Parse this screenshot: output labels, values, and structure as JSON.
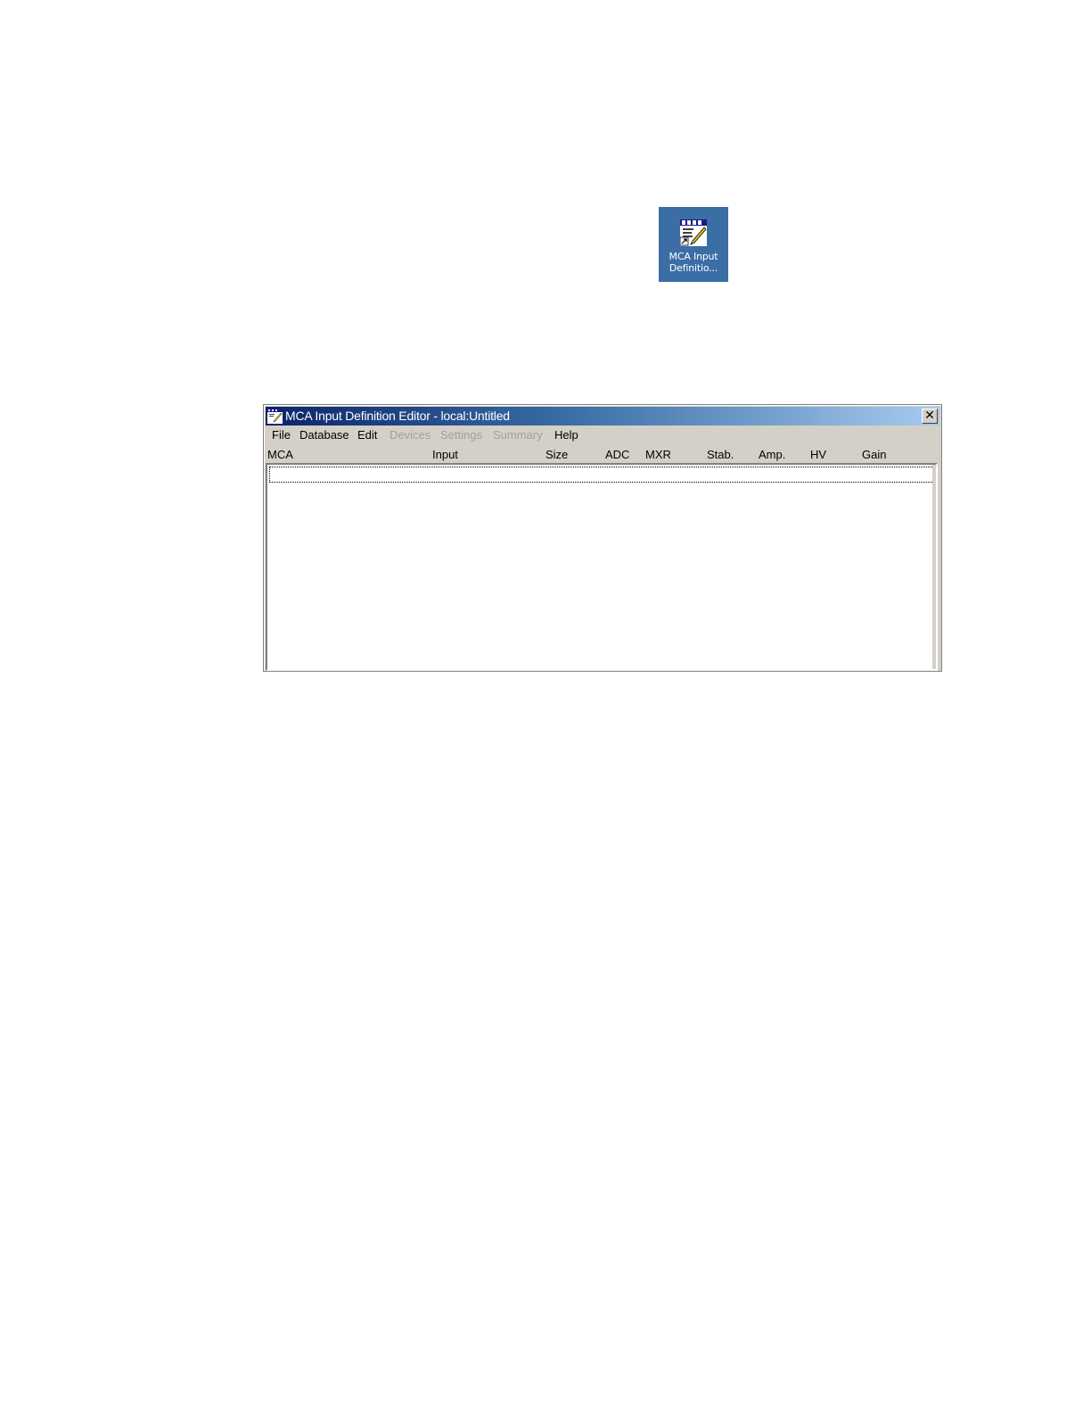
{
  "desktop_shortcut": {
    "label": "MCA Input\nDefinitio...",
    "icon": "mid-editor-icon",
    "background_color": "#3a6ea5"
  },
  "window": {
    "title": "MCA Input Definition Editor - local:Untitled",
    "app_icon": "mid-editor-icon",
    "close_label": "✕",
    "menu": [
      {
        "label": "File",
        "enabled": true
      },
      {
        "label": "Database",
        "enabled": true
      },
      {
        "label": "Edit",
        "enabled": true
      },
      {
        "label": "Devices",
        "enabled": false
      },
      {
        "label": "Settings",
        "enabled": false
      },
      {
        "label": "Summary",
        "enabled": false
      },
      {
        "label": "Help",
        "enabled": true
      }
    ],
    "columns": [
      "MCA",
      "Input",
      "Size",
      "ADC",
      "MXR",
      "Stab.",
      "Amp.",
      "HV",
      "Gain"
    ],
    "rows": [],
    "title_gradient": [
      "#0a246a",
      "#a6caf0"
    ],
    "face_color": "#d4d0c8"
  }
}
